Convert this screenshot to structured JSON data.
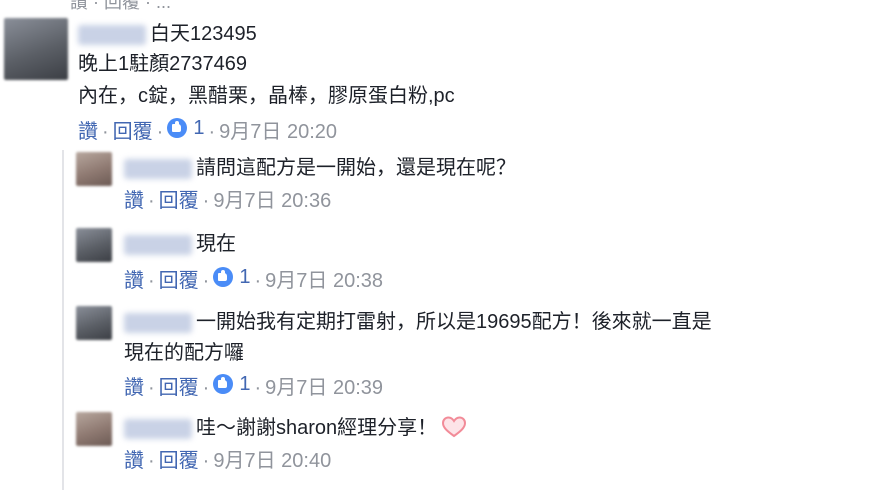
{
  "top_cut_text": "讚 · 回覆 · ...",
  "comments": [
    {
      "lines": [
        "白天123495",
        "晚上1駐顏2737469",
        "內在，c錠，黑醋栗，晶棒，膠原蛋白粉,pc"
      ],
      "like_label": "讚",
      "reply_label": "回覆",
      "reactions": "1",
      "time": "9月7日 20:20"
    }
  ],
  "replies": [
    {
      "text": "請問這配方是一開始，還是現在呢？",
      "like_label": "讚",
      "reply_label": "回覆",
      "reactions": "",
      "time": "9月7日 20:36"
    },
    {
      "text": "現在",
      "like_label": "讚",
      "reply_label": "回覆",
      "reactions": "1",
      "time": "9月7日 20:38"
    },
    {
      "text_line1": "一開始我有定期打雷射，所以是19695配方！後來就一直是",
      "text_line2": "現在的配方囉",
      "like_label": "讚",
      "reply_label": "回覆",
      "reactions": "1",
      "time": "9月7日 20:39"
    },
    {
      "text": "哇～謝謝sharon經理分享！",
      "like_label": "讚",
      "reply_label": "回覆",
      "reactions": "",
      "time": "9月7日 20:40"
    }
  ],
  "icons": {
    "like": "like-reaction-icon",
    "heart": "heart-emoji-icon"
  },
  "colors": {
    "link": "#4267b2",
    "muted": "#90949c",
    "like_blue": "#4a8cf7",
    "heart_stroke": "#f28b98"
  }
}
